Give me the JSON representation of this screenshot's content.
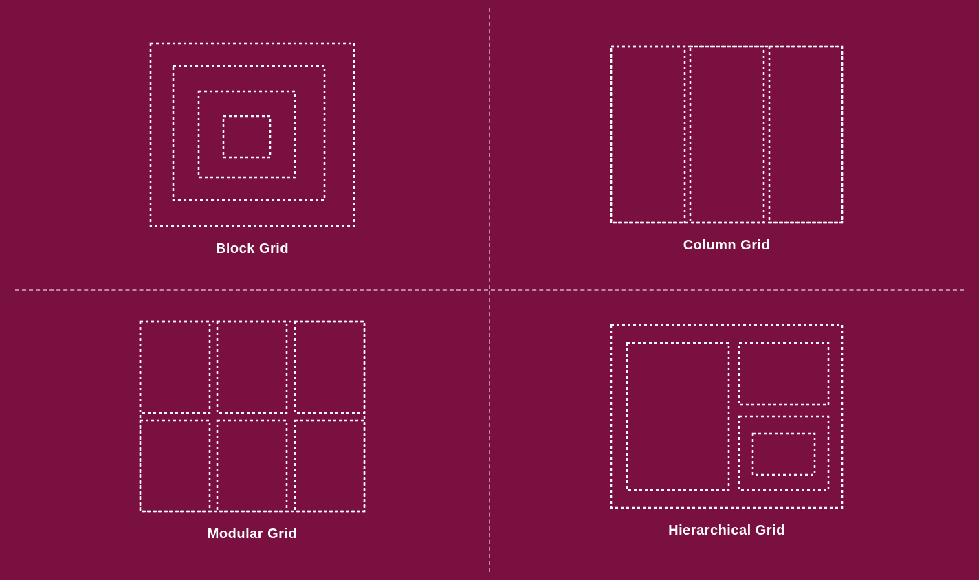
{
  "quadrants": [
    {
      "id": "block-grid",
      "label": "Block Grid",
      "position": "top-left"
    },
    {
      "id": "column-grid",
      "label": "Column Grid",
      "position": "top-right"
    },
    {
      "id": "modular-grid",
      "label": "Modular Grid",
      "position": "bottom-left"
    },
    {
      "id": "hierarchical-grid",
      "label": "Hierarchical Grid",
      "position": "bottom-right"
    }
  ],
  "colors": {
    "background": "#7a1040",
    "border": "#ffffff",
    "divider": "rgba(255,255,255,0.5)"
  }
}
